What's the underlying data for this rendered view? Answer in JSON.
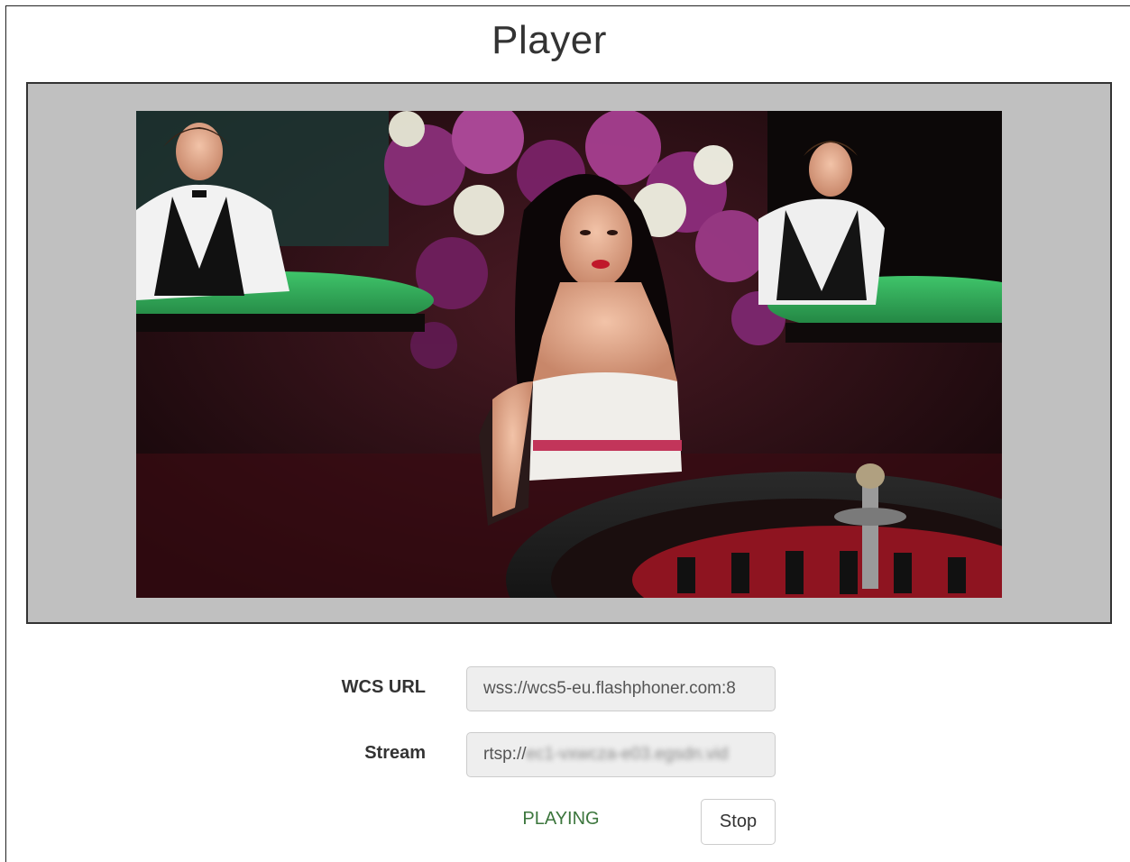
{
  "page": {
    "title": "Player"
  },
  "form": {
    "wcs_url": {
      "label": "WCS URL",
      "value": "wss://wcs5-eu.flashphoner.com:8"
    },
    "stream": {
      "label": "Stream",
      "value_visible": "rtsp://",
      "value_obscured": "ec1-vxwcza-e03.egsdn.vid"
    },
    "status": "PLAYING",
    "stop_label": "Stop"
  },
  "colors": {
    "status_green": "#3c763d",
    "player_bg": "#c0c0c0",
    "input_bg": "#eeeeee"
  }
}
